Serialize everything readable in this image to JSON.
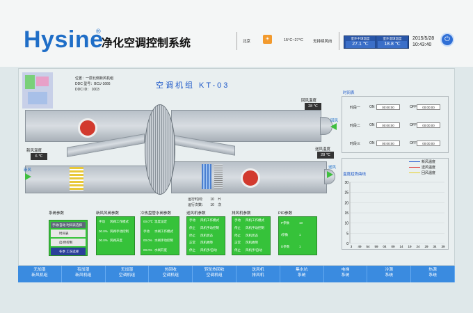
{
  "header": {
    "brand": "Hysine",
    "reg_mark": "®",
    "system_title": "净化空调控制系统",
    "city": "北京",
    "weather_icon": "sun-icon",
    "temp_range": "15°C~27°C",
    "wind": "无持续风向",
    "outdoor_dry": {
      "label": "室外干球温度",
      "value": "27.1 ℃"
    },
    "outdoor_wet": {
      "label": "室外湿球温度",
      "value": "18.8 ℃"
    },
    "date": "2015/5/28",
    "time": "10:43:40",
    "power_icon": "power-icon"
  },
  "unit": {
    "info": {
      "position": "位置：一层北侧新风机组",
      "ddc_model": "DDC 型号：BCU-1666",
      "ddc_id": "DDC ID：    1003"
    },
    "title": "空调机组 KT-03",
    "return_air_temp": {
      "label": "回风温度",
      "value": "28 ℃"
    },
    "fresh_air_temp": {
      "label": "新风温度",
      "value": "6 ℃"
    },
    "supply_air_temp": {
      "label": "送风温度",
      "value": "28 ℃"
    },
    "return_air": "回风",
    "fresh_air": "新风",
    "supply_air": "送风",
    "runtime": {
      "label": "运行时间：",
      "value": "10",
      "unit": "H"
    },
    "runcount": {
      "label": "运行次数：",
      "value": "10",
      "unit": "次"
    }
  },
  "panels": {
    "system": {
      "header": "系统参数",
      "mode_label": "手动/自动",
      "mode_value": "时间表选择",
      "schedule": "时间表",
      "startstop": "启/停控制",
      "season_label": "冬季",
      "season_value": "工况选择"
    },
    "fresh_damper": {
      "header": "新风风阀参数",
      "rows": [
        [
          "手动",
          "风阀工作模式"
        ],
        [
          "00.0%",
          "风阀手动控制"
        ],
        [
          "00.0%",
          "风阀开度"
        ]
      ]
    },
    "coil_valve": {
      "header": "冷热盘管水阀参数",
      "rows": [
        [
          "00.0℃",
          "温度设定"
        ],
        [
          "手动",
          "水阀工作模式"
        ],
        [
          "00.0%",
          "水阀手动控制"
        ],
        [
          "00.0%",
          "水阀开度"
        ]
      ]
    },
    "supply_fan": {
      "header": "送风机参数",
      "rows": [
        [
          "手动",
          "风机工作模式"
        ],
        [
          "停止",
          "风机手动控制"
        ],
        [
          "停止",
          "风机状态"
        ],
        [
          "正常",
          "风机故障"
        ],
        [
          "停止",
          "风机手/自动"
        ]
      ]
    },
    "exhaust_fan": {
      "header": "排风机参数",
      "rows": [
        [
          "手动",
          "风机工作模式"
        ],
        [
          "停止",
          "风机手动控制"
        ],
        [
          "停止",
          "风机状态"
        ],
        [
          "正常",
          "风机故障"
        ],
        [
          "停止",
          "风机手/自动"
        ]
      ]
    },
    "pid": {
      "header": "PID参数",
      "rows": [
        [
          "P参数",
          "10"
        ],
        [
          "I参数",
          "1"
        ],
        [
          "D参数",
          "1"
        ]
      ]
    }
  },
  "schedule": {
    "title": "时间表",
    "rows": [
      {
        "name": "时段一",
        "on_label": "ON",
        "on": "00:00:00",
        "off_label": "OFF",
        "off": "00:00:00"
      },
      {
        "name": "时段二",
        "on_label": "ON",
        "on": "00:00:00",
        "off_label": "OFF",
        "off": "00:00:00"
      },
      {
        "name": "时段三",
        "on_label": "ON",
        "on": "00:00:00",
        "off_label": "OFF",
        "off": "00:00:00"
      }
    ]
  },
  "trend": {
    "title": "温度趋势曲线",
    "legend": [
      {
        "name": "新风温度",
        "color": "#2a5bd0"
      },
      {
        "name": "送风温度",
        "color": "#e03030"
      },
      {
        "name": "回风温度",
        "color": "#e8d020"
      }
    ],
    "yticks": [
      "30",
      "25",
      "20",
      "15",
      "10",
      "5",
      "0"
    ],
    "xticks": [
      "3",
      "49",
      "54",
      "59",
      "04",
      "09",
      "14",
      "19",
      "24",
      "29",
      "34",
      "39"
    ]
  },
  "nav": [
    [
      "无加湿",
      "新风机组"
    ],
    [
      "有加湿",
      "新风机组"
    ],
    [
      "无加湿",
      "空调机组"
    ],
    [
      "热回收",
      "空调机组"
    ],
    [
      "转轮热回收",
      "空调机组"
    ],
    [
      "送风机",
      "排风机"
    ],
    [
      "集水坑",
      "系统"
    ],
    [
      "电梯",
      "系统"
    ],
    [
      "冷源",
      "系统"
    ],
    [
      "热源",
      "系统"
    ]
  ]
}
